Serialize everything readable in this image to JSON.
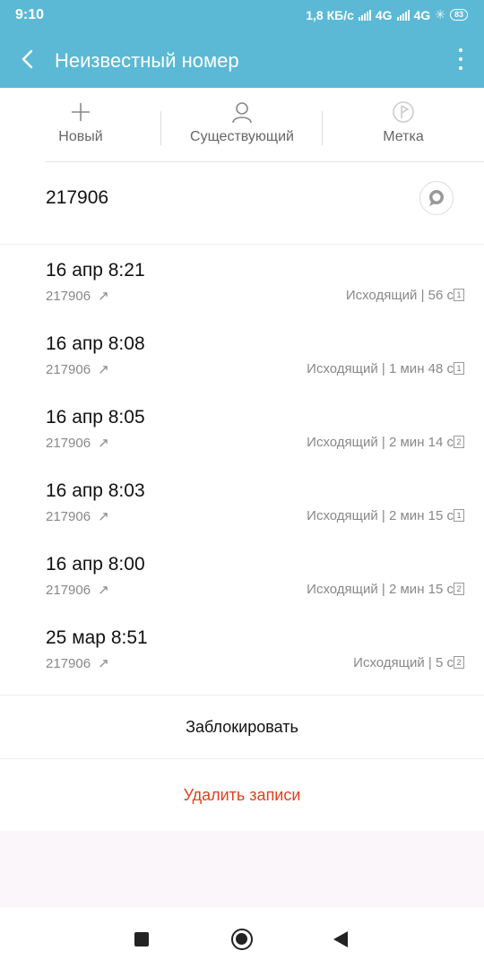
{
  "status": {
    "time": "9:10",
    "speed": "1,8 КБ/с",
    "net1": "4G",
    "net2": "4G",
    "battery": "83"
  },
  "appbar": {
    "title": "Неизвестный номер",
    "back_icon": "chevron-left-icon",
    "menu_icon": "more-vert-icon"
  },
  "actions": [
    {
      "label": "Новый",
      "icon": "plus-icon"
    },
    {
      "label": "Существующий",
      "icon": "person-icon"
    },
    {
      "label": "Метка",
      "icon": "tag-icon"
    }
  ],
  "number": "217906",
  "calls": [
    {
      "datetime": "16 апр 8:21",
      "number": "217906",
      "info": "Исходящий | 56 с",
      "sim": "1"
    },
    {
      "datetime": "16 апр 8:08",
      "number": "217906",
      "info": "Исходящий | 1 мин 48 с",
      "sim": "1"
    },
    {
      "datetime": "16 апр 8:05",
      "number": "217906",
      "info": "Исходящий | 2 мин 14 с",
      "sim": "2"
    },
    {
      "datetime": "16 апр 8:03",
      "number": "217906",
      "info": "Исходящий | 2 мин 15 с",
      "sim": "1"
    },
    {
      "datetime": "16 апр 8:00",
      "number": "217906",
      "info": "Исходящий | 2 мин 15 с",
      "sim": "2"
    },
    {
      "datetime": "25 мар 8:51",
      "number": "217906",
      "info": "Исходящий | 5 с",
      "sim": "2"
    }
  ],
  "block_label": "Заблокировать",
  "delete_label": "Удалить записи",
  "colors": {
    "accent": "#5bb9d6",
    "danger": "#e0401c"
  }
}
